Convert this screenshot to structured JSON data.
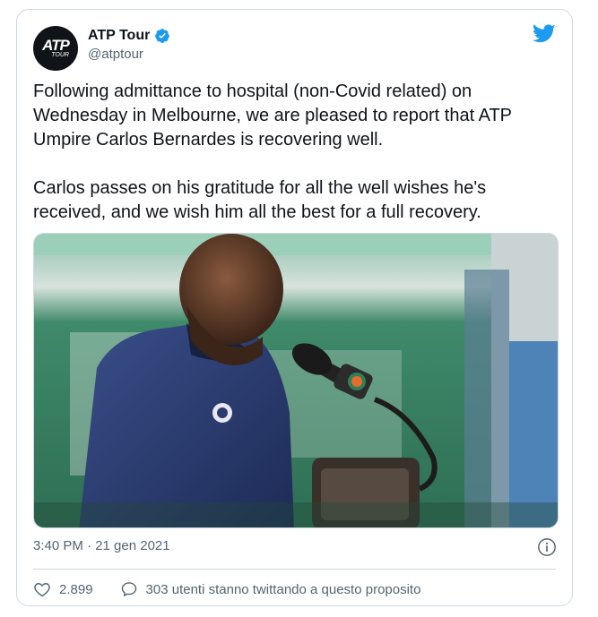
{
  "tweet": {
    "author": {
      "display_name": "ATP Tour",
      "handle": "@atptour",
      "avatar_text": "ATP",
      "avatar_subtext": "TOUR",
      "verified": true,
      "avatar_icon": "atp-tour-logo"
    },
    "paragraphs": [
      "Following admittance to hospital (non-Covid related) on Wednesday in Melbourne, we are pleased to report that ATP Umpire Carlos Bernardes is recovering well.",
      "Carlos passes on his gratitude for all the well wishes he's received, and we wish him all the best for a full recovery."
    ],
    "timestamp": "3:40 PM · 21 gen 2021",
    "likes": "2.899",
    "conversation": "303 utenti stanno twittando a questo proposito"
  },
  "icons": {
    "brand": "twitter-bird-icon",
    "verified": "verified-badge-icon",
    "info": "info-icon",
    "like": "heart-icon",
    "reply": "speech-bubble-icon"
  },
  "colors": {
    "twitter_blue": "#1d9bf0",
    "text_primary": "#0f1419",
    "text_secondary": "#536471",
    "border": "#cfd9de"
  }
}
